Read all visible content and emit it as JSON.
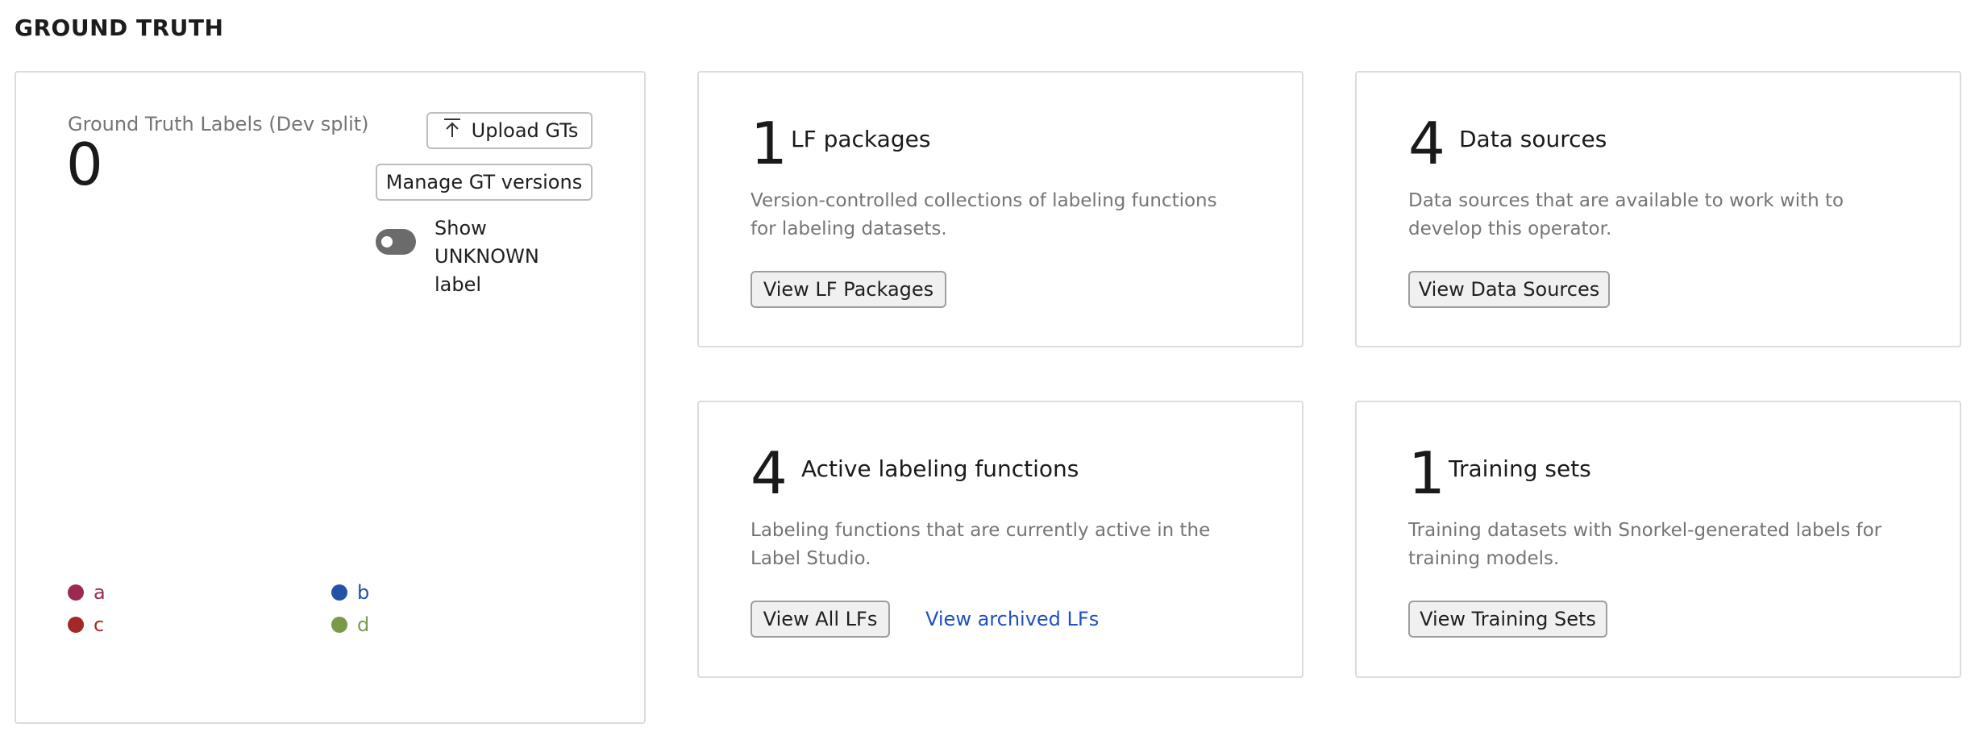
{
  "section_title": "GROUND TRUTH",
  "ground_truth": {
    "label": "Ground Truth Labels (Dev split)",
    "count": "0",
    "upload_button": "Upload GTs",
    "manage_button": "Manage GT versions",
    "toggle_label": "Show UNKNOWN label",
    "toggle_on": false,
    "legend": [
      {
        "label": "a",
        "color": "#9b2a52"
      },
      {
        "label": "b",
        "color": "#2352a5"
      },
      {
        "label": "c",
        "color": "#a32929"
      },
      {
        "label": "d",
        "color": "#7a9a4a"
      }
    ]
  },
  "cards": {
    "lf_packages": {
      "count": "1",
      "title": "LF packages",
      "description": "Version-controlled collections of labeling functions for labeling datasets.",
      "button": "View LF Packages"
    },
    "data_sources": {
      "count": "4",
      "title": "Data sources",
      "description": "Data sources that are available to work with to develop this operator.",
      "button": "View Data Sources"
    },
    "active_lfs": {
      "count": "4",
      "title": "Active labeling functions",
      "description": "Labeling functions that are currently active in the Label Studio.",
      "button": "View All LFs",
      "link": "View archived LFs"
    },
    "training_sets": {
      "count": "1",
      "title": "Training sets",
      "description": "Training datasets with Snorkel-generated labels for training models.",
      "button": "View Training Sets"
    }
  }
}
